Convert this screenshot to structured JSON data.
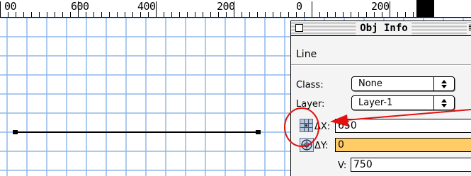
{
  "ruler": {
    "labels": [
      "00",
      "600",
      "400",
      "200",
      "0",
      "200"
    ]
  },
  "obj_info": {
    "title": "Obj Info",
    "zoom_glyph": "≣",
    "object_type": "Line",
    "class": {
      "label": "Class:",
      "value": "None"
    },
    "layer": {
      "label": "Layer:",
      "value": "Layer-1"
    },
    "delta_x": {
      "label": "ΔX:",
      "value": "650"
    },
    "delta_y": {
      "label": "ΔY:",
      "value": "0"
    },
    "next_row": {
      "label": "V:",
      "value": "750"
    }
  },
  "colors": {
    "grid": "#8fb8ea",
    "annotation": "#e31010",
    "active_field": "#ffcc66"
  },
  "icons": {
    "close": "close-box-icon",
    "zoom": "zoom-box-icon",
    "popup": "up-down-arrows-icon",
    "position": "nine-point-grid-icon",
    "rotation": "rotation-dial-icon"
  }
}
